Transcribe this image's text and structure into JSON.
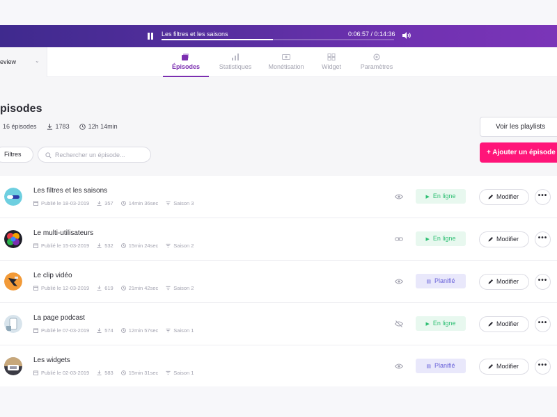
{
  "player": {
    "title": "Les filtres et les saisons",
    "time": "0:06:57 / 0:14:36",
    "progress": 0.48
  },
  "header": {
    "show_name": "eview",
    "tabs": [
      {
        "label": "Épisodes",
        "icon": "episodes-icon",
        "active": true
      },
      {
        "label": "Statistiques",
        "icon": "stats-icon",
        "active": false
      },
      {
        "label": "Monétisation",
        "icon": "monetization-icon",
        "active": false
      },
      {
        "label": "Widget",
        "icon": "widget-icon",
        "active": false
      },
      {
        "label": "Paramètres",
        "icon": "settings-icon",
        "active": false
      }
    ]
  },
  "page": {
    "title": "pisodes",
    "stats": {
      "episodes": "16 épisodes",
      "downloads": "1783",
      "duration": "12h 14min"
    },
    "filters_label": "Filtres",
    "search_placeholder": "Rechercher un épisode...",
    "playlists_label": "Voir les playlists",
    "add_label": "+ Ajouter un épisode"
  },
  "episodes": [
    {
      "title": "Les filtres et les saisons",
      "published": "Publié le 18-03-2019",
      "downloads": "357",
      "duration": "14min 36sec",
      "season": "Saison 3",
      "status": "En ligne",
      "status_type": "online",
      "visibility": "eye-icon",
      "edit": "Modifier",
      "more": "•••"
    },
    {
      "title": "Le multi-utilisateurs",
      "published": "Publié le 15-03-2019",
      "downloads": "532",
      "duration": "15min 24sec",
      "season": "Saison 2",
      "status": "En ligne",
      "status_type": "online",
      "visibility": "link-icon",
      "edit": "Modifier",
      "more": "•••"
    },
    {
      "title": "Le clip vidéo",
      "published": "Publié le 12-03-2019",
      "downloads": "619",
      "duration": "21min 42sec",
      "season": "Saison 2",
      "status": "Planifié",
      "status_type": "planned",
      "visibility": "eye-icon",
      "edit": "Modifier",
      "more": "•••"
    },
    {
      "title": "La page podcast",
      "published": "Publié le 07-03-2019",
      "downloads": "574",
      "duration": "12min 57sec",
      "season": "Saison 1",
      "status": "En ligne",
      "status_type": "online",
      "visibility": "eye-off-icon",
      "edit": "Modifier",
      "more": "•••"
    },
    {
      "title": "Les widgets",
      "published": "Publié le 02-03-2019",
      "downloads": "583",
      "duration": "15min 31sec",
      "season": "Saison 1",
      "status": "Planifié",
      "status_type": "planned",
      "visibility": "eye-icon",
      "edit": "Modifier",
      "more": "•••"
    }
  ],
  "colors": {
    "brand_purple": "#7b2eb0",
    "accent_pink": "#ff1579",
    "online_green": "#2ebf73",
    "planned_indigo": "#6a63d9"
  }
}
